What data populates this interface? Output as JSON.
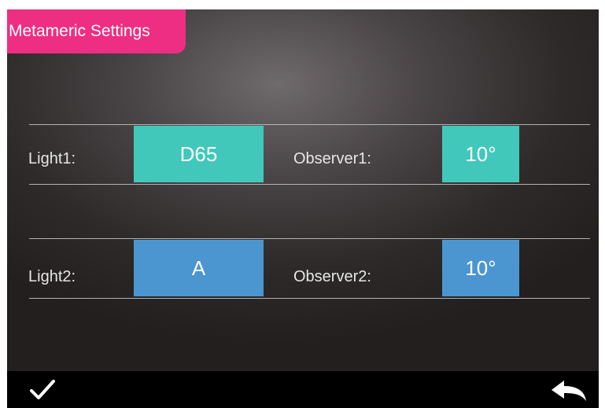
{
  "title": "Metameric Settings",
  "rows": [
    {
      "light_label": "Light1:",
      "light_value": "D65",
      "observer_label": "Observer1:",
      "observer_value": "10°",
      "color": "#41c8ba"
    },
    {
      "light_label": "Light2:",
      "light_value": "A",
      "observer_label": "Observer2:",
      "observer_value": "10°",
      "color": "#4b95d0"
    }
  ],
  "icons": {
    "confirm": "check-icon",
    "back": "back-arrow-icon"
  },
  "colors": {
    "title_bg": "#ee2e82",
    "bar_bg": "#000000"
  }
}
